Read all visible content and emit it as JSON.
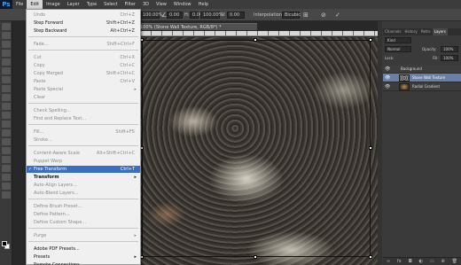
{
  "app": {
    "logo": "Ps"
  },
  "menubar": {
    "items": [
      "File",
      "Edit",
      "Image",
      "Layer",
      "Type",
      "Select",
      "Filter",
      "3D",
      "View",
      "Window",
      "Help"
    ],
    "active": "Edit"
  },
  "options": {
    "zoom_w": "100.00%",
    "rot": "0.00",
    "h_val": "100.00%",
    "h_label": "H:",
    "h_angle": "0.00",
    "v_val": "0.00",
    "v_label": "V:",
    "interp_label": "Interpolation:",
    "interp_value": "Bicubic"
  },
  "document": {
    "tab_title": "100% (Stone Wall Texture, RGB/8*) *"
  },
  "edit_menu": {
    "items": [
      {
        "label": "Undo",
        "shortcut": "Ctrl+Z",
        "state": "disabled"
      },
      {
        "label": "Step Forward",
        "shortcut": "Shift+Ctrl+Z",
        "state": "normal"
      },
      {
        "label": "Step Backward",
        "shortcut": "Alt+Ctrl+Z",
        "state": "normal"
      },
      {
        "label": "Fade...",
        "shortcut": "Shift+Ctrl+F",
        "state": "disabled"
      },
      {
        "label": "Cut",
        "shortcut": "Ctrl+X",
        "state": "disabled"
      },
      {
        "label": "Copy",
        "shortcut": "Ctrl+C",
        "state": "disabled"
      },
      {
        "label": "Copy Merged",
        "shortcut": "Shift+Ctrl+C",
        "state": "disabled"
      },
      {
        "label": "Paste",
        "shortcut": "Ctrl+V",
        "state": "disabled"
      },
      {
        "label": "Paste Special",
        "shortcut": "",
        "state": "submenu-disabled"
      },
      {
        "label": "Clear",
        "shortcut": "",
        "state": "disabled"
      },
      {
        "label": "Check Spelling...",
        "shortcut": "",
        "state": "disabled"
      },
      {
        "label": "Find and Replace Text...",
        "shortcut": "",
        "state": "disabled"
      },
      {
        "label": "Fill...",
        "shortcut": "Shift+F5",
        "state": "disabled"
      },
      {
        "label": "Stroke...",
        "shortcut": "",
        "state": "disabled"
      },
      {
        "label": "Content-Aware Scale",
        "shortcut": "Alt+Shift+Ctrl+C",
        "state": "disabled"
      },
      {
        "label": "Puppet Warp",
        "shortcut": "",
        "state": "disabled"
      },
      {
        "label": "Free Transform",
        "shortcut": "Ctrl+T",
        "state": "highlight"
      },
      {
        "label": "Transform",
        "shortcut": "",
        "state": "bold-submenu"
      },
      {
        "label": "Auto-Align Layers...",
        "shortcut": "",
        "state": "disabled"
      },
      {
        "label": "Auto-Blend Layers...",
        "shortcut": "",
        "state": "disabled"
      },
      {
        "label": "Define Brush Preset...",
        "shortcut": "",
        "state": "disabled"
      },
      {
        "label": "Define Pattern...",
        "shortcut": "",
        "state": "disabled"
      },
      {
        "label": "Define Custom Shape...",
        "shortcut": "",
        "state": "disabled"
      },
      {
        "label": "Purge",
        "shortcut": "",
        "state": "submenu-disabled"
      },
      {
        "label": "Adobe PDF Presets...",
        "shortcut": "",
        "state": "normal"
      },
      {
        "label": "Presets",
        "shortcut": "",
        "state": "submenu"
      },
      {
        "label": "Remote Connections...",
        "shortcut": "",
        "state": "normal"
      }
    ]
  },
  "panels": {
    "tabs": [
      "Channels",
      "History",
      "Paths",
      "Layers"
    ],
    "active_tab": "Layers",
    "kind": "Kind",
    "blend": "Normal",
    "opacity_label": "Opacity:",
    "opacity": "100%",
    "lock_label": "Lock:",
    "fill_label": "Fill:",
    "fill": "100%",
    "layers": [
      {
        "name": "Background",
        "type": "group"
      },
      {
        "name": "Stone Wall Texture",
        "type": "layer",
        "selected": true
      },
      {
        "name": "Radial Gradient",
        "type": "layer"
      }
    ]
  },
  "colors": {
    "accent": "#3a6ec0",
    "menu_bg": "#f0f0f0",
    "ui_dark": "#3a3a3a"
  }
}
